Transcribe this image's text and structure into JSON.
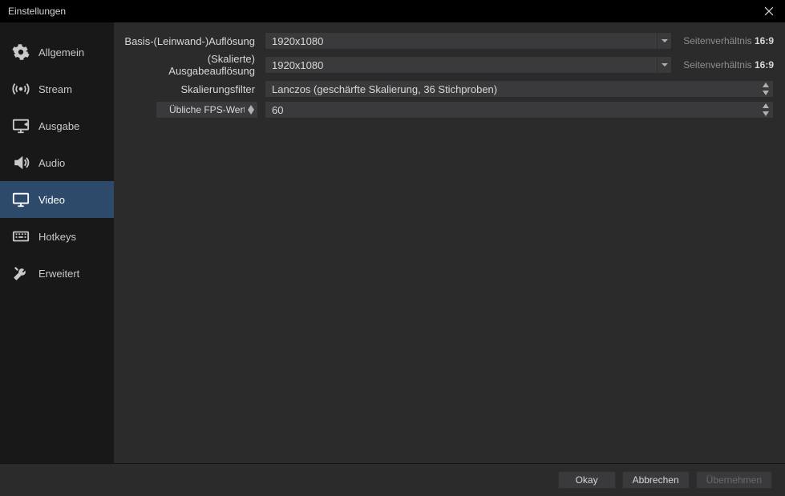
{
  "window": {
    "title": "Einstellungen"
  },
  "sidebar": {
    "items": [
      {
        "label": "Allgemein"
      },
      {
        "label": "Stream"
      },
      {
        "label": "Ausgabe"
      },
      {
        "label": "Audio"
      },
      {
        "label": "Video"
      },
      {
        "label": "Hotkeys"
      },
      {
        "label": "Erweitert"
      }
    ],
    "active_index": 4
  },
  "form": {
    "base_res_label": "Basis-(Leinwand-)Auflösung",
    "base_res_value": "1920x1080",
    "base_res_ratio_prefix": "Seitenverhältnis ",
    "base_res_ratio_value": "16:9",
    "scaled_res_label": "(Skalierte) Ausgabeauflösung",
    "scaled_res_value": "1920x1080",
    "scaled_res_ratio_prefix": "Seitenverhältnis ",
    "scaled_res_ratio_value": "16:9",
    "scaling_filter_label": "Skalierungsfilter",
    "scaling_filter_value": "Lanczos (geschärfte Skalierung, 36 Stichproben)",
    "fps_mode_label": "Übliche FPS-Werte",
    "fps_value": "60"
  },
  "footer": {
    "ok": "Okay",
    "cancel": "Abbrechen",
    "apply": "Übernehmen"
  }
}
